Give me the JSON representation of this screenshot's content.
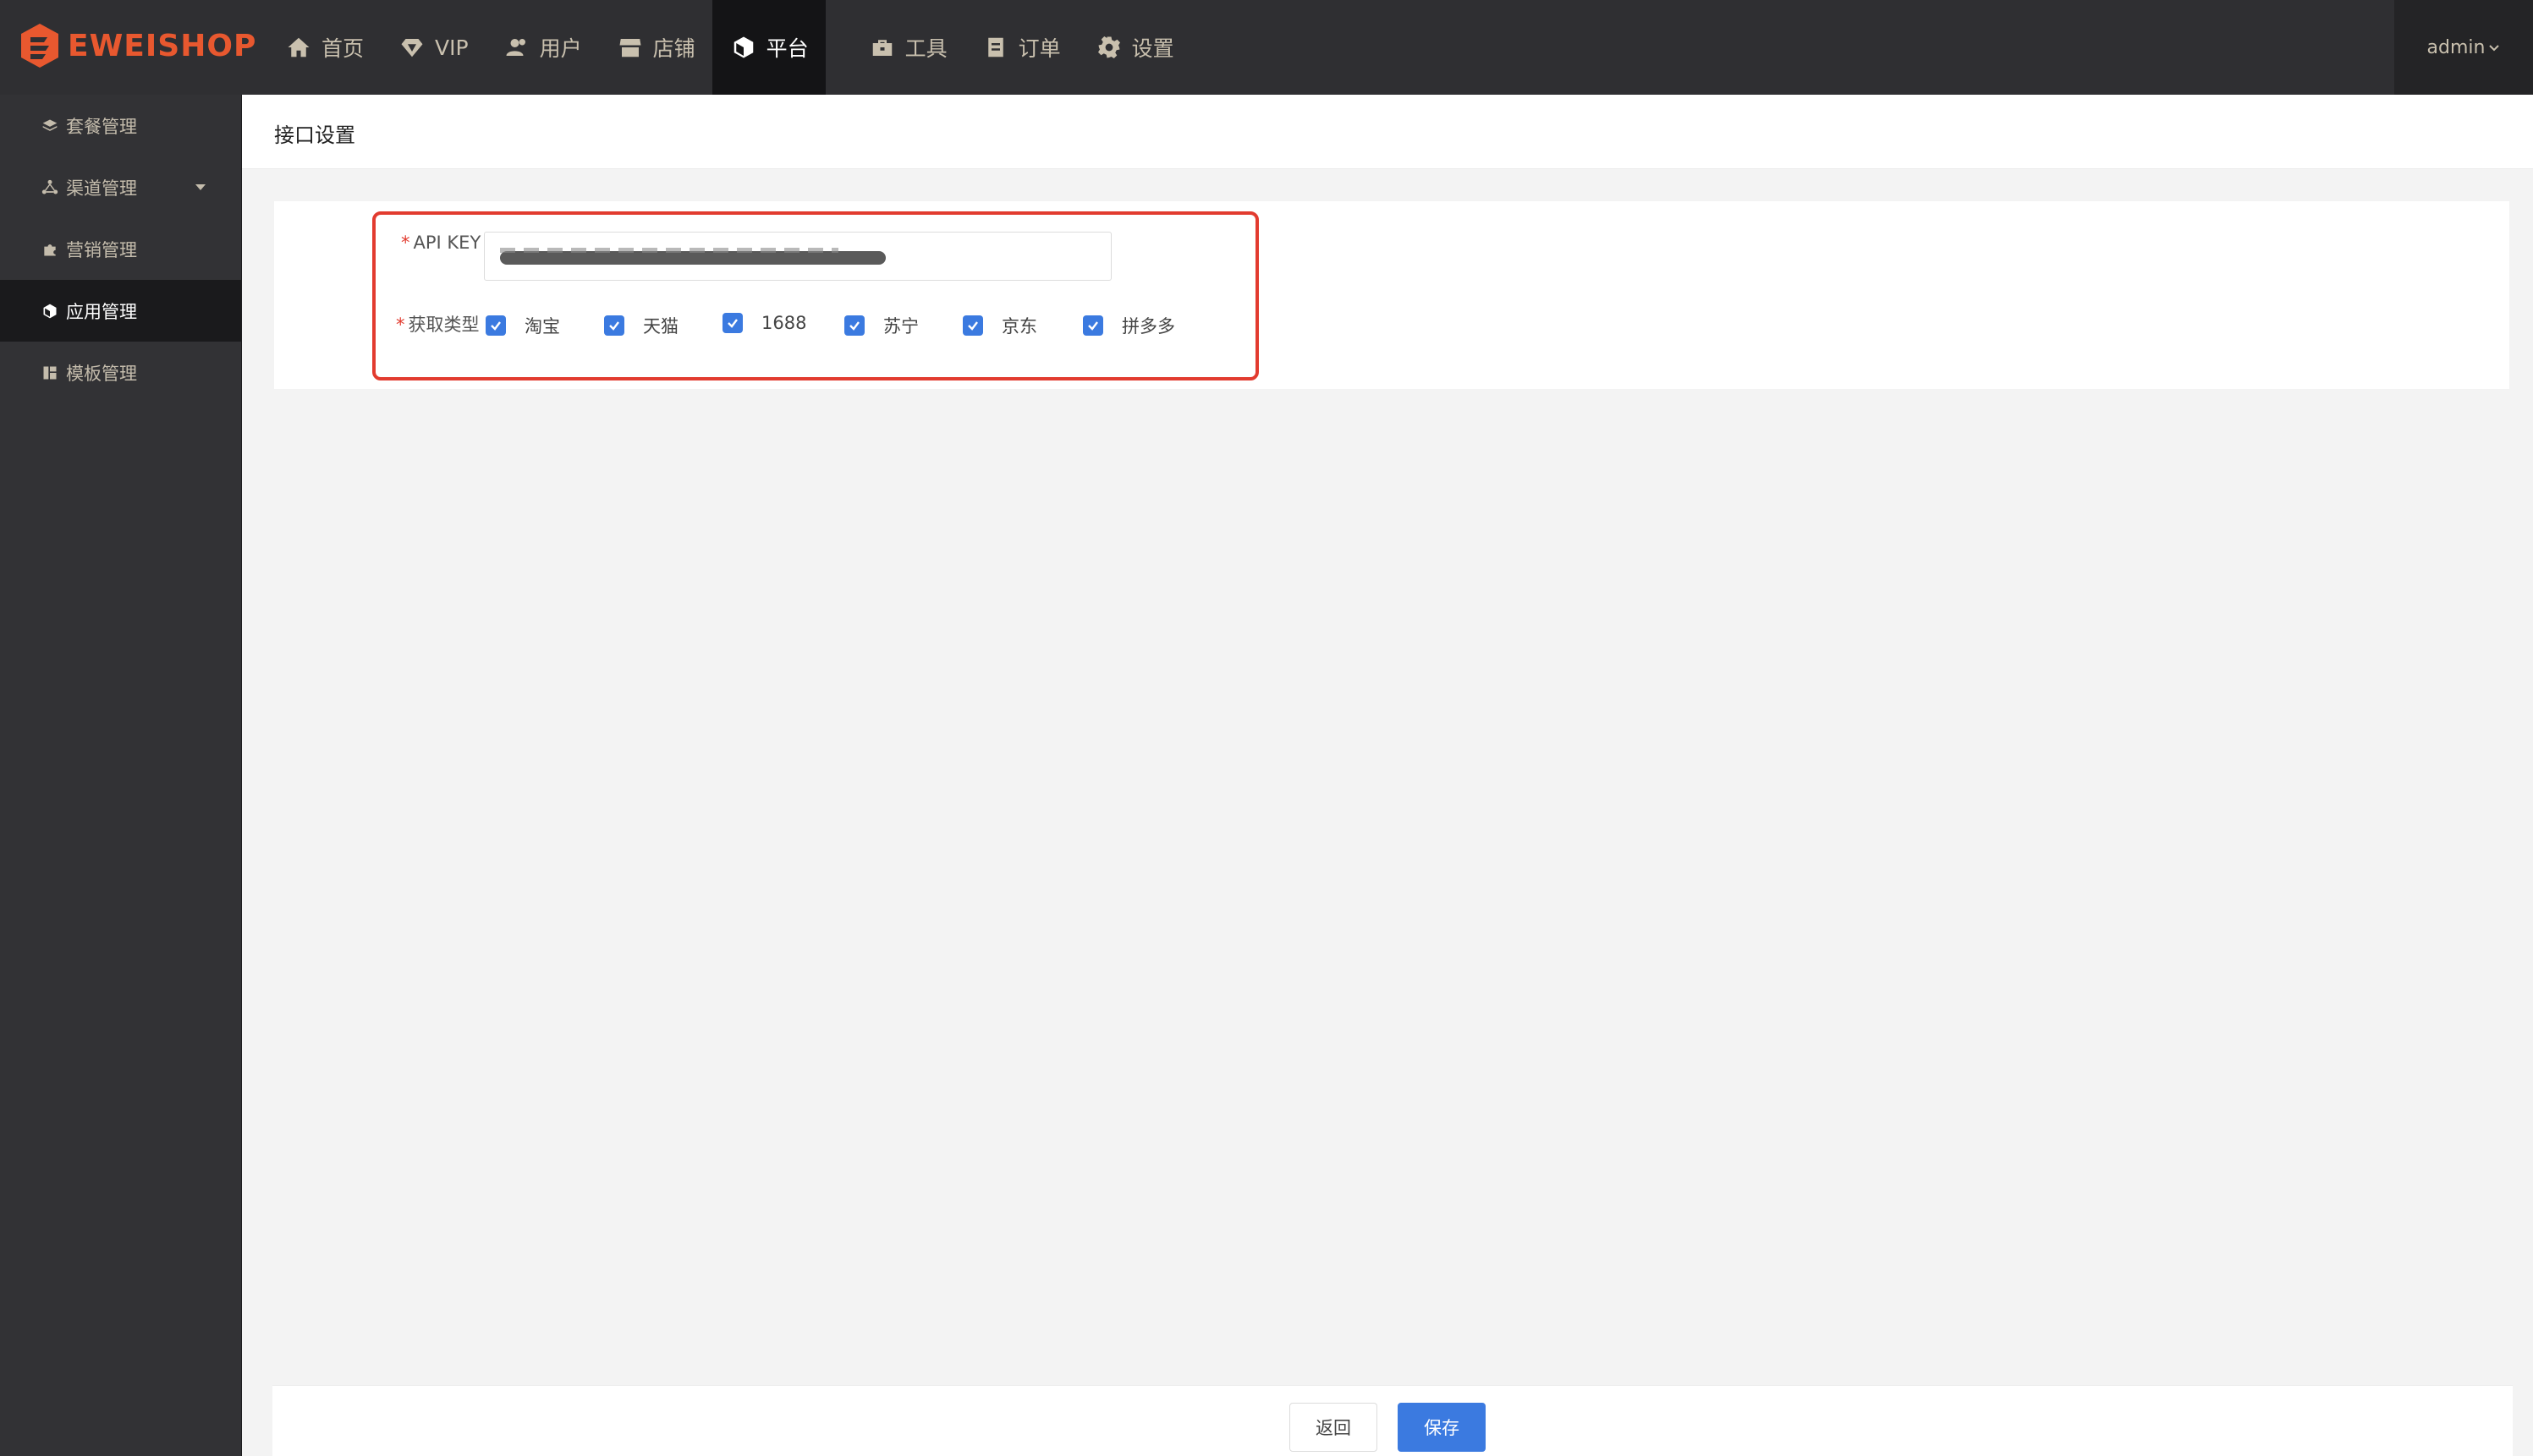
{
  "brand": {
    "name": "EWEISHOP",
    "color": "#e8582f"
  },
  "nav": {
    "items": [
      {
        "label": "首页",
        "icon": "home-icon",
        "active": false
      },
      {
        "label": "VIP",
        "icon": "diamond-icon",
        "active": false
      },
      {
        "label": "用户",
        "icon": "users-icon",
        "active": false
      },
      {
        "label": "店铺",
        "icon": "store-icon",
        "active": false
      },
      {
        "label": "平台",
        "icon": "cube-icon",
        "active": true
      },
      {
        "label": "工具",
        "icon": "toolbox-icon",
        "active": false
      },
      {
        "label": "订单",
        "icon": "document-icon",
        "active": false
      },
      {
        "label": "设置",
        "icon": "gear-icon",
        "active": false
      }
    ],
    "user": "admin"
  },
  "sidebar": {
    "items": [
      {
        "label": "套餐管理",
        "icon": "layers-icon",
        "active": false
      },
      {
        "label": "渠道管理",
        "icon": "share-icon",
        "active": false,
        "has_submenu": true
      },
      {
        "label": "营销管理",
        "icon": "puzzle-icon",
        "active": false
      },
      {
        "label": "应用管理",
        "icon": "cube-icon",
        "active": true
      },
      {
        "label": "模板管理",
        "icon": "template-icon",
        "active": false
      }
    ]
  },
  "page": {
    "title": "接口设置"
  },
  "form": {
    "api_key": {
      "label": "API KEY",
      "required": true,
      "value_masked": true
    },
    "fetch_type": {
      "label": "获取类型",
      "required": true,
      "options": [
        {
          "label": "淘宝",
          "checked": true
        },
        {
          "label": "天猫",
          "checked": true
        },
        {
          "label": "1688",
          "checked": true
        },
        {
          "label": "苏宁",
          "checked": true
        },
        {
          "label": "京东",
          "checked": true
        },
        {
          "label": "拼多多",
          "checked": true
        }
      ]
    }
  },
  "footer": {
    "back_label": "返回",
    "save_label": "保存"
  },
  "colors": {
    "accent": "#3b7ae0",
    "highlight_border": "#e23b2f",
    "topbar": "#2f2f32",
    "sidebar": "#323235"
  }
}
